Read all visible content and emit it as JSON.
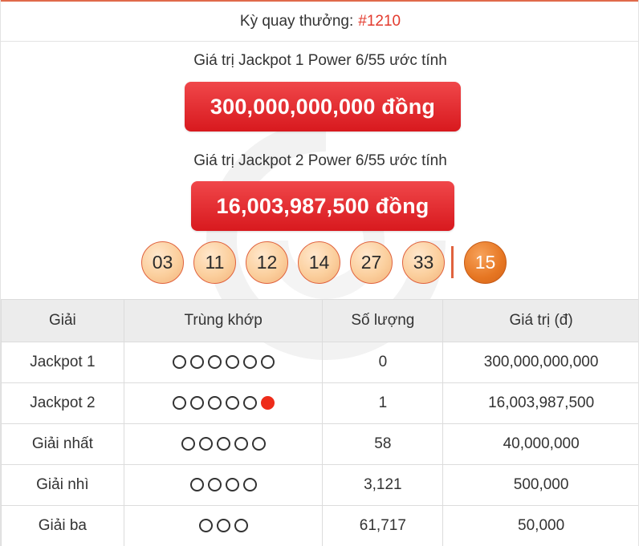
{
  "draw": {
    "label": "Kỳ quay thưởng:",
    "number": "#1210"
  },
  "jackpot1": {
    "label": "Giá trị Jackpot 1 Power 6/55 ước tính",
    "value": "300,000,000,000 đồng"
  },
  "jackpot2": {
    "label": "Giá trị Jackpot 2 Power 6/55 ước tính",
    "value": "16,003,987,500 đồng"
  },
  "balls": [
    "03",
    "11",
    "12",
    "14",
    "27",
    "33"
  ],
  "power_ball": "15",
  "colors": {
    "accent": "#e33b2e",
    "prize_box": "#e0282d",
    "ball": "#fbcf9d",
    "power_ball": "#e67622"
  },
  "table": {
    "headers": [
      "Giải",
      "Trùng khớp",
      "Số lượng",
      "Giá trị (đ)"
    ],
    "rows": [
      {
        "prize": "Jackpot 1",
        "match_count": 6,
        "power_match": false,
        "quantity": "0",
        "value": "300,000,000,000",
        "value_highlight": true
      },
      {
        "prize": "Jackpot 2",
        "match_count": 5,
        "power_match": true,
        "quantity": "1",
        "value": "16,003,987,500",
        "value_highlight": true
      },
      {
        "prize": "Giải nhất",
        "match_count": 5,
        "power_match": false,
        "quantity": "58",
        "value": "40,000,000",
        "value_highlight": false
      },
      {
        "prize": "Giải nhì",
        "match_count": 4,
        "power_match": false,
        "quantity": "3,121",
        "value": "500,000",
        "value_highlight": false
      },
      {
        "prize": "Giải ba",
        "match_count": 3,
        "power_match": false,
        "quantity": "61,717",
        "value": "50,000",
        "value_highlight": false
      }
    ]
  }
}
